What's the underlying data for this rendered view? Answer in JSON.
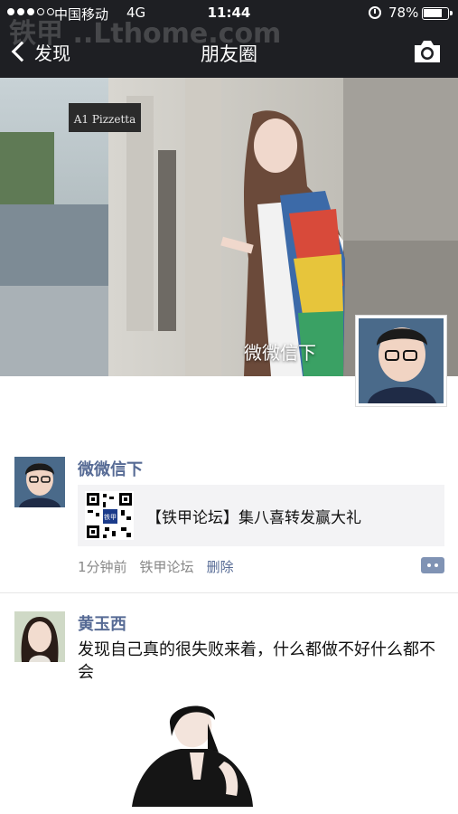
{
  "status_bar": {
    "carrier": "中国移动",
    "network": "4G",
    "time": "11:44",
    "battery": "78%"
  },
  "nav": {
    "back_label": "发现",
    "title": "朋友圈"
  },
  "cover": {
    "sign_text": "A1 Pizzetta",
    "user_name": "微微信下"
  },
  "posts": [
    {
      "name": "微微信下",
      "share_title": "【铁甲论坛】集八喜转发赢大礼",
      "qr_label": "铁甲",
      "time": "1分钟前",
      "source": "铁甲论坛",
      "delete_label": "删除"
    },
    {
      "name": "黄玉西",
      "text": "发现自己真的很失败来着，什么都做不好什么都不会"
    }
  ],
  "watermark": "铁甲 ..Lthome.com",
  "colors": {
    "nav_bg": "#1e1f23",
    "name_link": "#576b95",
    "share_bg": "#f3f3f5"
  },
  "icons": [
    "chevron-left-icon",
    "camera-icon",
    "alarm-icon",
    "battery-icon",
    "more-icon",
    "qr-code-icon"
  ]
}
